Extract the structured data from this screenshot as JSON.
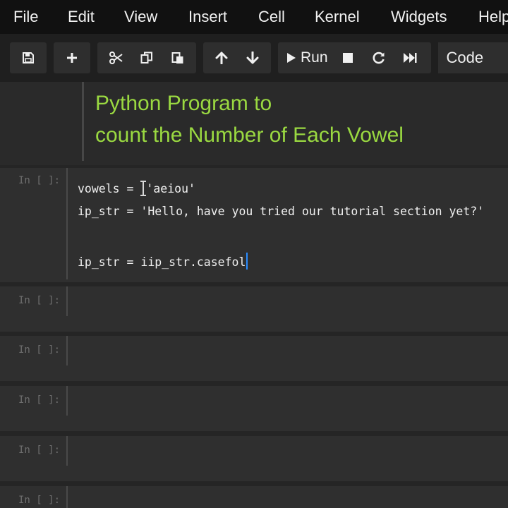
{
  "menubar": {
    "items": [
      "File",
      "Edit",
      "View",
      "Insert",
      "Cell",
      "Kernel",
      "Widgets",
      "Help"
    ]
  },
  "toolbar": {
    "run_label": "Run",
    "cell_type": "Code",
    "icons": [
      "save-icon",
      "plus-icon",
      "scissors-icon",
      "copy-icon",
      "paste-icon",
      "arrow-up-icon",
      "arrow-down-icon",
      "play-icon",
      "stop-icon",
      "restart-icon",
      "fast-forward-icon"
    ]
  },
  "markdown_cell": {
    "line1": "Python Program to",
    "line2": "count the Number of Each Vowel"
  },
  "code_cell": {
    "prompt": "In [ ]:",
    "line1_a": "vowels = ",
    "line1_b": "'aeiou'",
    "line2": "ip_str = 'Hello, have you tried our tutorial section yet?'",
    "line3": "ip_str = iip_str.casefol"
  },
  "empty_cells": {
    "prompt": "In [ ]:"
  },
  "colors": {
    "markdown_text": "#9ad941",
    "cursor": "#2a8cff",
    "menubar_bg": "#111111"
  }
}
